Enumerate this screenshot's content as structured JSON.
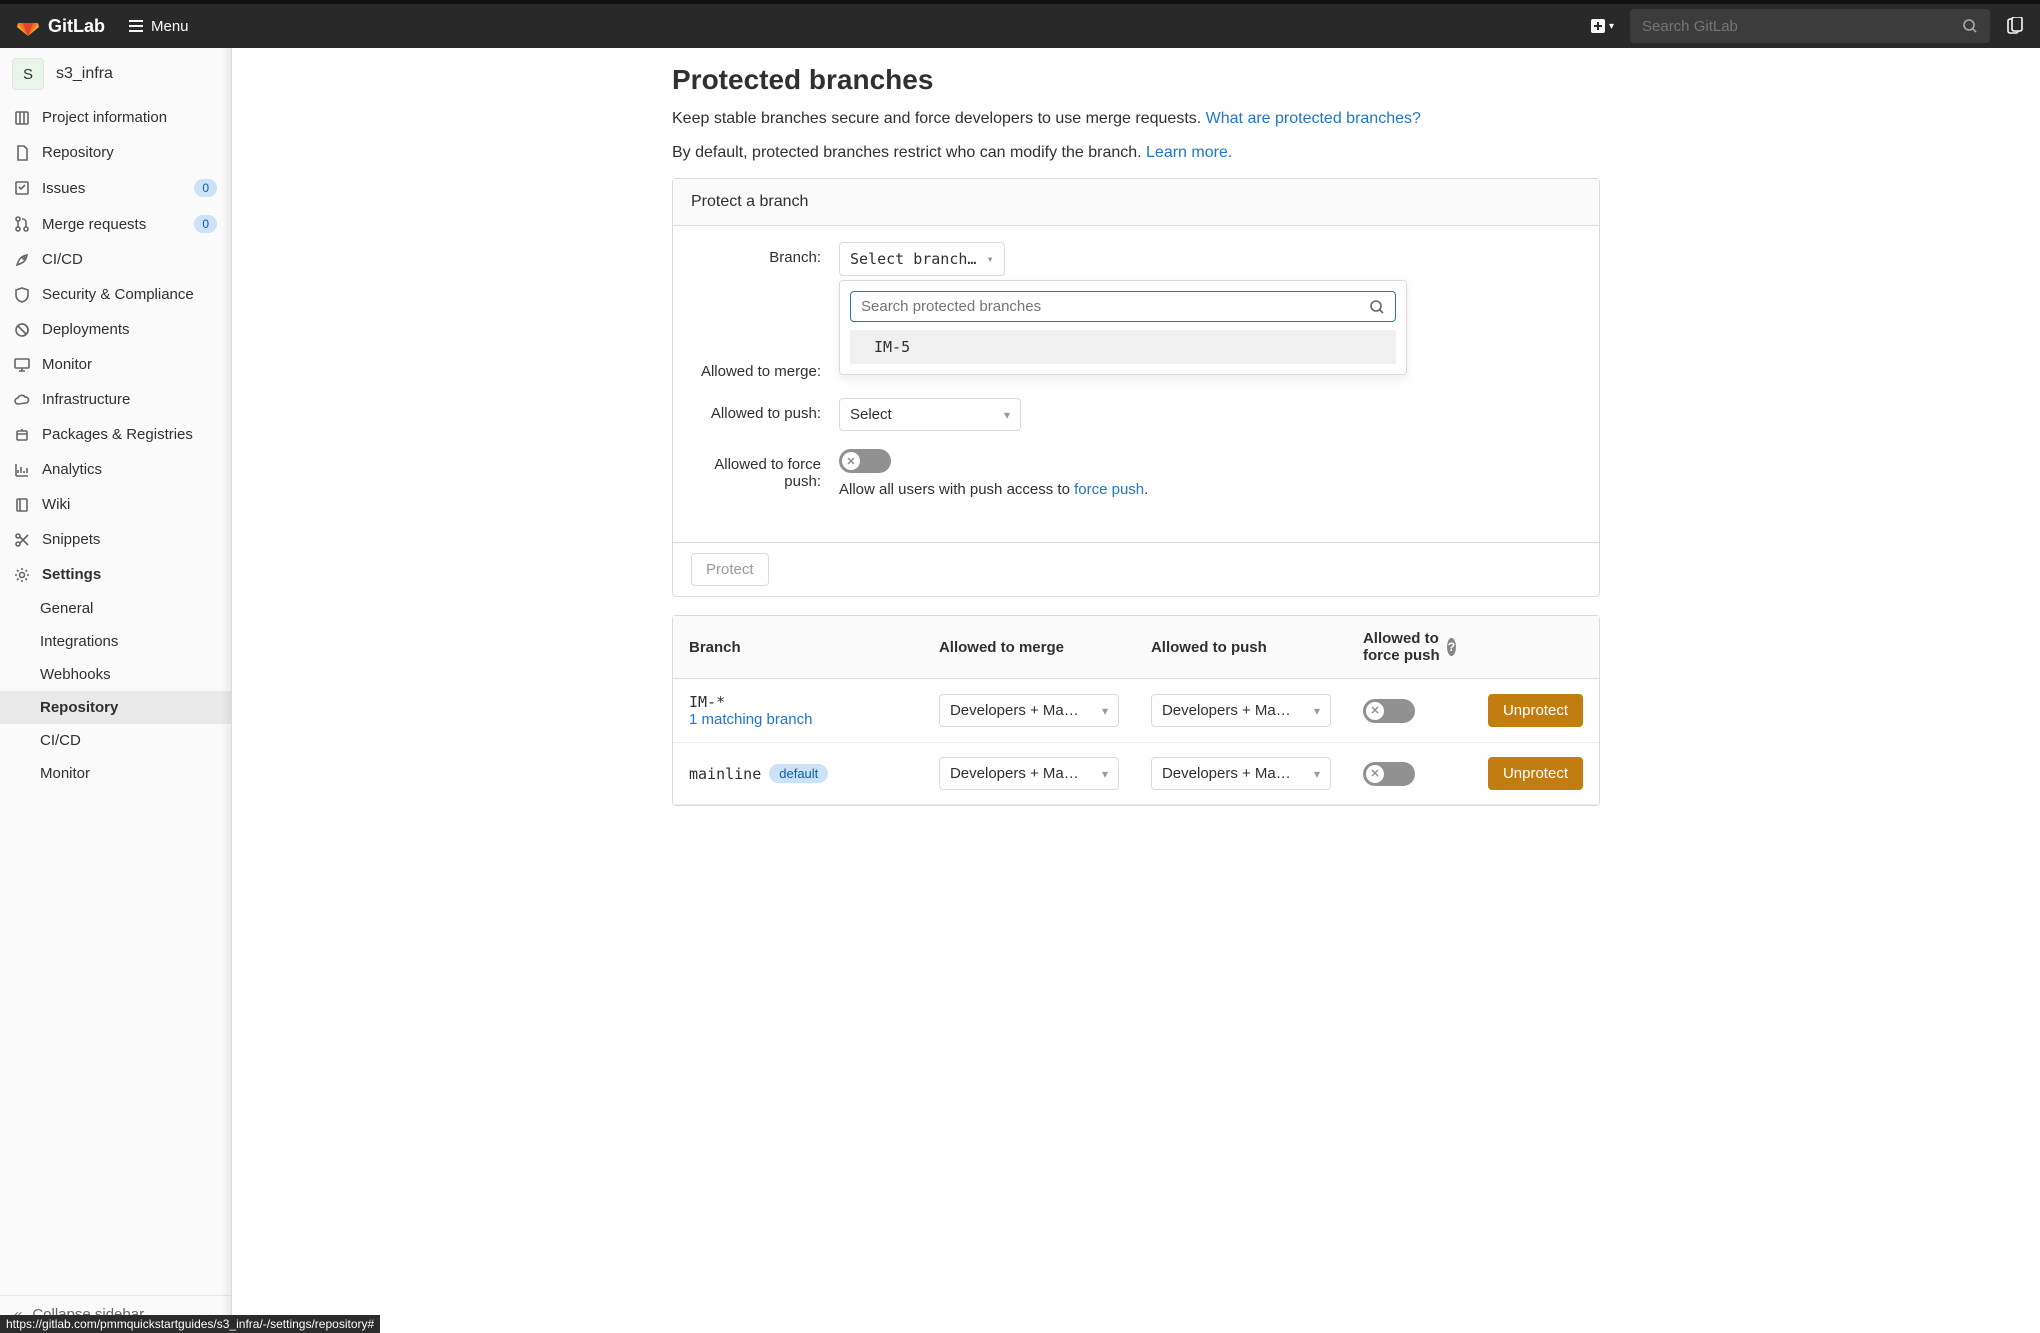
{
  "topbar": {
    "brand": "GitLab",
    "menu_label": "Menu",
    "search_placeholder": "Search GitLab"
  },
  "sidebar": {
    "project_initial": "S",
    "project_name": "s3_infra",
    "items": [
      {
        "label": "Project information"
      },
      {
        "label": "Repository"
      },
      {
        "label": "Issues",
        "badge": "0"
      },
      {
        "label": "Merge requests",
        "badge": "0"
      },
      {
        "label": "CI/CD"
      },
      {
        "label": "Security & Compliance"
      },
      {
        "label": "Deployments"
      },
      {
        "label": "Monitor"
      },
      {
        "label": "Infrastructure"
      },
      {
        "label": "Packages & Registries"
      },
      {
        "label": "Analytics"
      },
      {
        "label": "Wiki"
      },
      {
        "label": "Snippets"
      },
      {
        "label": "Settings"
      }
    ],
    "settings_sub": [
      "General",
      "Integrations",
      "Webhooks",
      "Repository",
      "CI/CD",
      "Monitor"
    ],
    "collapse_label": "Collapse sidebar"
  },
  "page": {
    "title": "Protected branches",
    "desc_text": "Keep stable branches secure and force developers to use merge requests. ",
    "desc_link": "What are protected branches?",
    "subdesc_text": "By default, protected branches restrict who can modify the branch. ",
    "subdesc_link": "Learn more."
  },
  "form": {
    "panel_title": "Protect a branch",
    "branch_label": "Branch:",
    "branch_select": "Select branch…",
    "branch_search_placeholder": "Search protected branches",
    "branch_option": "IM-5",
    "merge_label": "Allowed to merge:",
    "push_label": "Allowed to push:",
    "push_select": "Select",
    "force_label": "Allowed to force push:",
    "force_desc_pre": "Allow all users with push access to ",
    "force_desc_link": "force push",
    "force_desc_post": ".",
    "protect_button": "Protect"
  },
  "table": {
    "headers": {
      "branch": "Branch",
      "merge": "Allowed to merge",
      "push": "Allowed to push",
      "force": "Allowed to force push"
    },
    "role_value": "Developers + Ma…",
    "unprotect": "Unprotect",
    "rows": [
      {
        "name": "IM-*",
        "sub": "1 matching branch",
        "default": false
      },
      {
        "name": "mainline",
        "default": true,
        "default_label": "default"
      }
    ]
  },
  "statusbar": "https://gitlab.com/pmmquickstartguides/s3_infra/-/settings/repository#"
}
